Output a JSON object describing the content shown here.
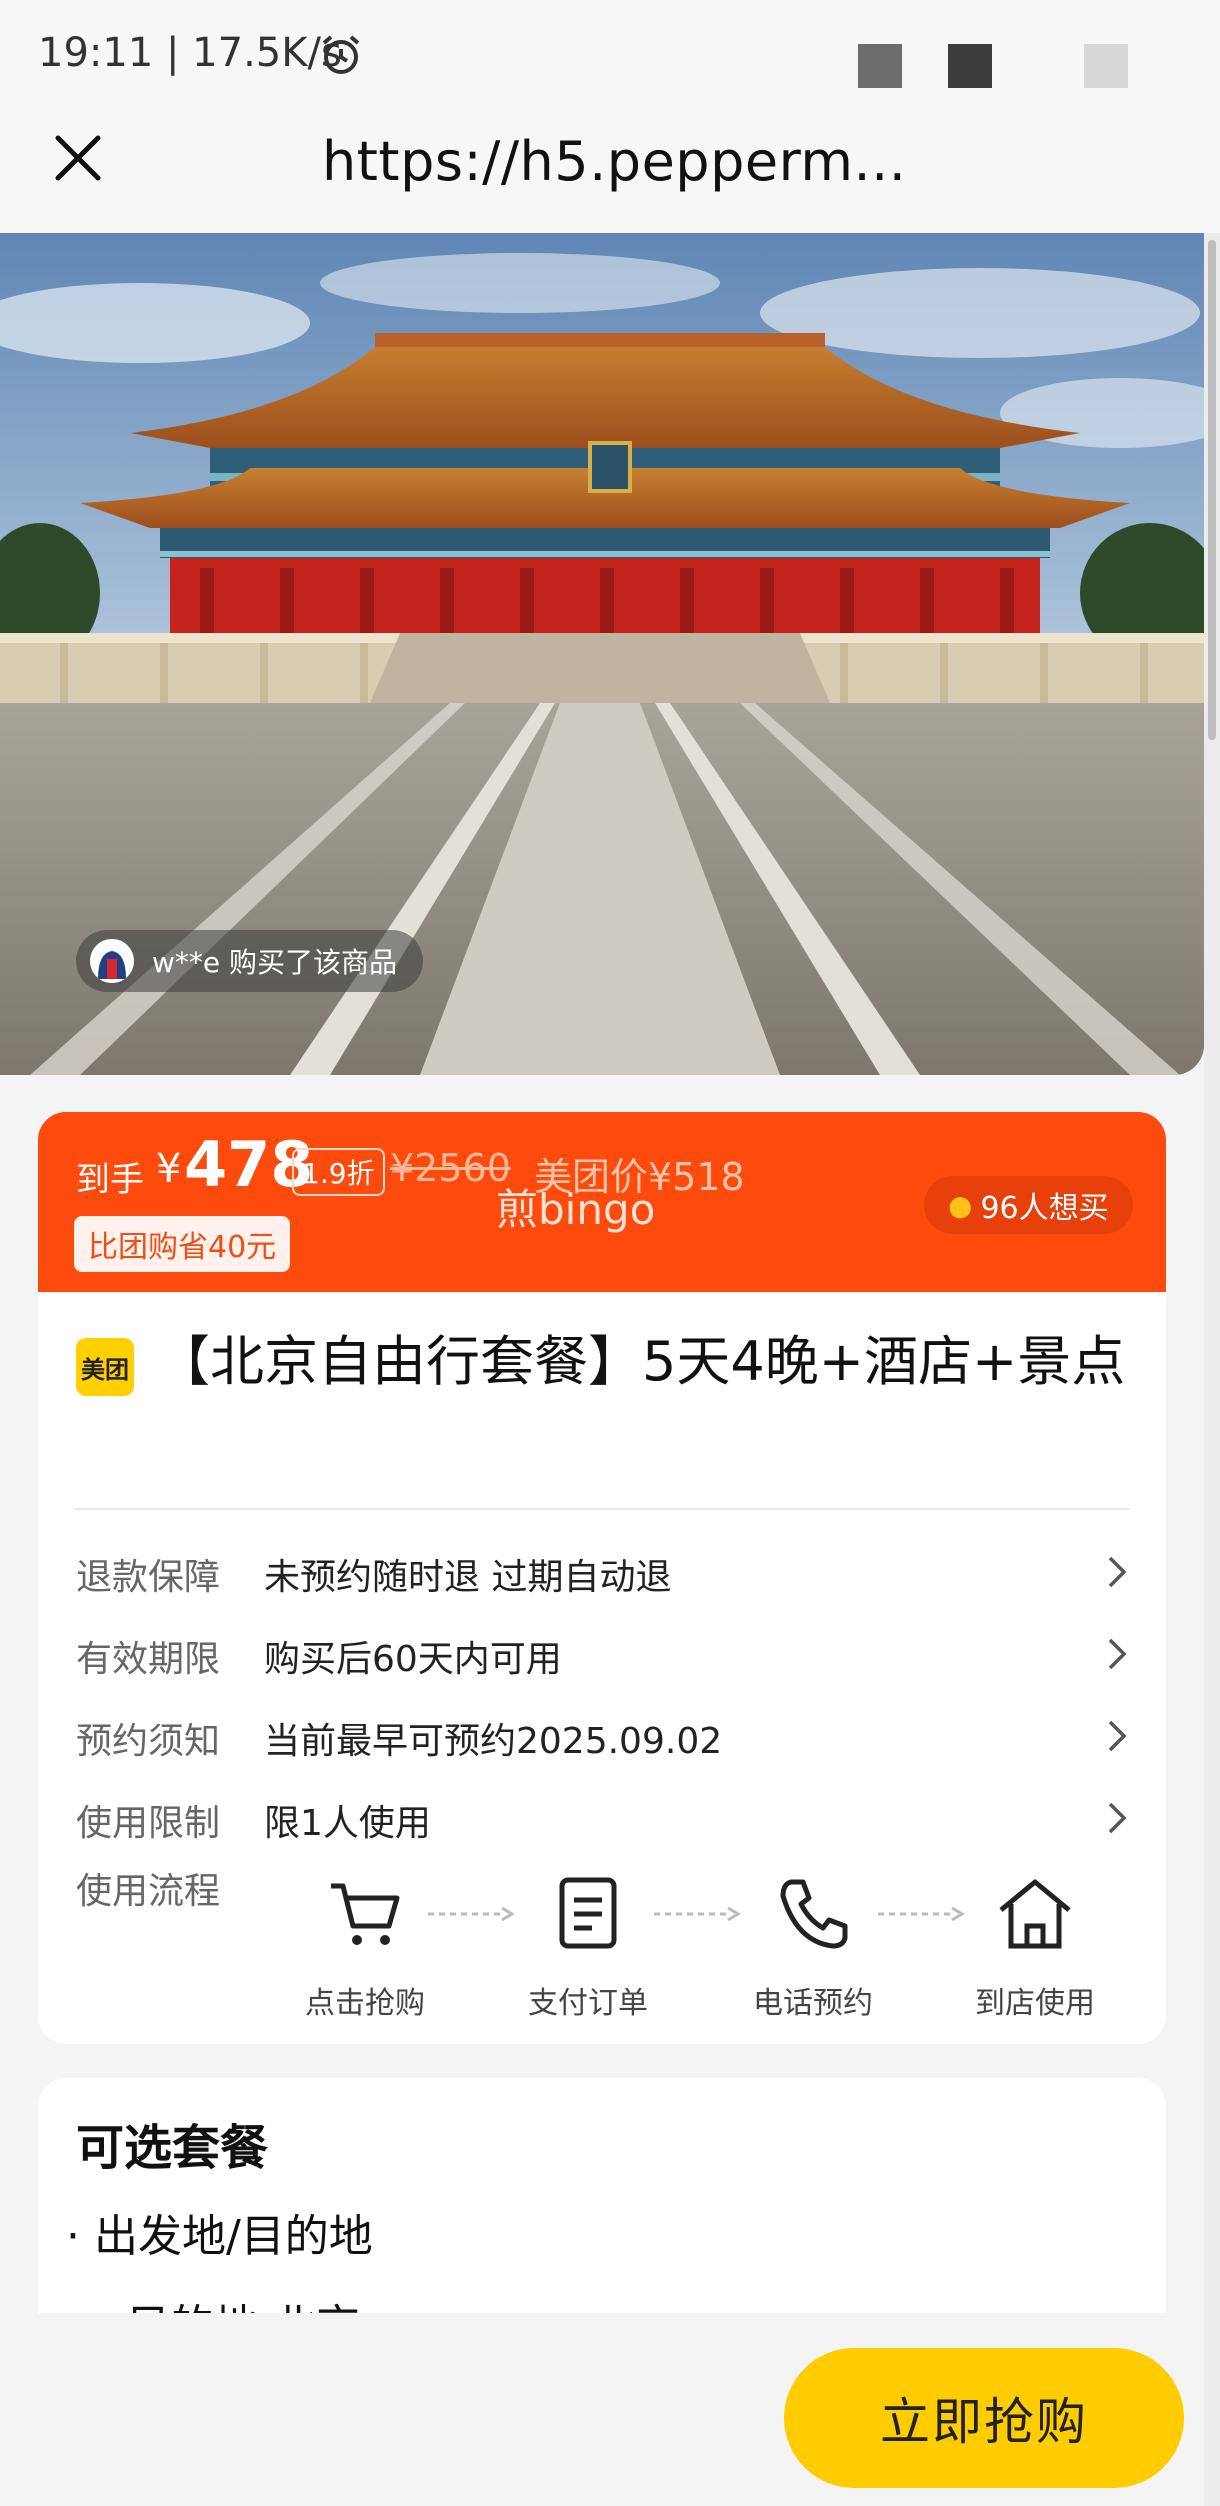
{
  "status_bar": {
    "time": "19:11 | 17.5K/s"
  },
  "nav": {
    "url": "https://h5.pepperm..."
  },
  "hero": {
    "buyer_text": "w**e 购买了该商品"
  },
  "price": {
    "label": "到手",
    "currency": "¥",
    "amount": "478",
    "discount": "1.9折",
    "original": "¥2560",
    "meituan_price": "美团价¥518",
    "watermark": "煎bingo",
    "save_badge": "比团购省40元",
    "want_count": "96人想买"
  },
  "product": {
    "brand": "美团",
    "title": "【北京自由行套餐】5天4晚+酒店+景点"
  },
  "info_rows": [
    {
      "key": "退款保障",
      "value": "未预约随时退 过期自动退"
    },
    {
      "key": "有效期限",
      "value": "购买后60天内可用"
    },
    {
      "key": "预约须知",
      "value": "当前最早可预约2025.09.02"
    },
    {
      "key": "使用限制",
      "value": "限1人使用"
    }
  ],
  "process": {
    "label": "使用流程",
    "steps": [
      {
        "label": "点击抢购",
        "icon": "cart-icon"
      },
      {
        "label": "支付订单",
        "icon": "document-icon"
      },
      {
        "label": "电话预约",
        "icon": "phone-icon"
      },
      {
        "label": "到店使用",
        "icon": "home-icon"
      }
    ]
  },
  "packages": {
    "title": "可选套餐",
    "item1": "· 出发地/目的地",
    "item2": "· 目的地 北京"
  },
  "cta": {
    "label": "立即抢购"
  },
  "colors": {
    "accent": "#fd4b0d",
    "cta": "#ffcc00",
    "brand": "#ffd000"
  }
}
